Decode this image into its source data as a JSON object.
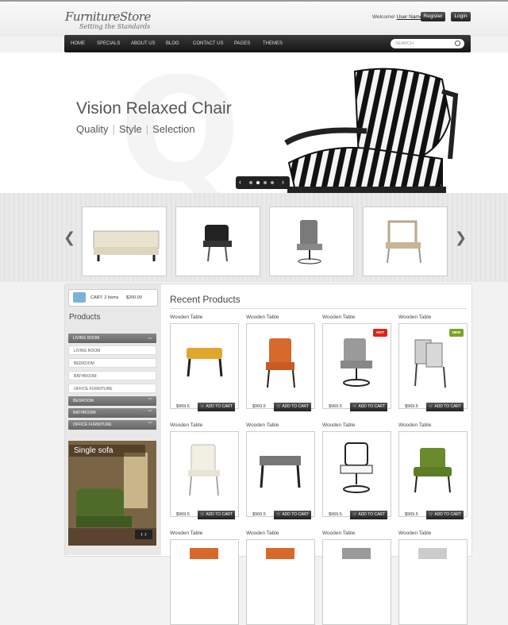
{
  "header": {
    "logo_brand": "FurnitureStore",
    "logo_tagline": "Setting the Standards",
    "welcome_text": "Welcome!",
    "user_name": "User Name",
    "register_label": "Register",
    "login_label": "Login"
  },
  "nav": {
    "items": [
      "HOME",
      "SPECIALS",
      "ABOUT US",
      "BLOG",
      "CONTACT US",
      "PAGES",
      "THEMES"
    ],
    "search_placeholder": "SEARCH"
  },
  "hero": {
    "title": "Vision Relaxed Chair",
    "sub": [
      "Quality",
      "Style",
      "Selection"
    ]
  },
  "sidebar": {
    "cart_text": "CART: 2 Items",
    "cart_total": "$200.00",
    "products_heading": "Products",
    "categories": [
      {
        "label": "LIVING ROOM",
        "style": "dark",
        "chev": "up"
      },
      {
        "label": "LIVING ROOM",
        "style": "light"
      },
      {
        "label": "BEDROOM",
        "style": "light"
      },
      {
        "label": "BATHROOM",
        "style": "light"
      },
      {
        "label": "OFFICE FURNITURE",
        "style": "light"
      },
      {
        "label": "BEDROOM",
        "style": "dark",
        "chev": "down"
      },
      {
        "label": "BATHROOM",
        "style": "dark",
        "chev": "down"
      },
      {
        "label": "OFFICE FURNITURE",
        "style": "dark",
        "chev": "down"
      }
    ],
    "feature_label": "Single sofa"
  },
  "recent": {
    "heading": "Recent Products",
    "products": [
      {
        "name": "Wooden Table",
        "price": "$969.5",
        "button": "ADD TO CART",
        "badge": ""
      },
      {
        "name": "Wooden Table",
        "price": "$969.5",
        "button": "ADD TO CART",
        "badge": ""
      },
      {
        "name": "Wooden Table",
        "price": "$969.5",
        "button": "ADD TO CART",
        "badge": "HOT"
      },
      {
        "name": "Wooden Table",
        "price": "$969.5",
        "button": "ADD TO CART",
        "badge": "NEW"
      },
      {
        "name": "Wooden Table",
        "price": "$969.5",
        "button": "ADD TO CART",
        "badge": ""
      },
      {
        "name": "Wooden Table",
        "price": "$969.5",
        "button": "ADD TO CART",
        "badge": ""
      },
      {
        "name": "Wooden Table",
        "price": "$969.5",
        "button": "ADD TO CART",
        "badge": ""
      },
      {
        "name": "Wooden Table",
        "price": "$969.5",
        "button": "ADD TO CART",
        "badge": ""
      },
      {
        "name": "Wooden Table",
        "price": "",
        "button": "",
        "badge": ""
      },
      {
        "name": "Wooden Table",
        "price": "",
        "button": "",
        "badge": ""
      },
      {
        "name": "Wooden Table",
        "price": "",
        "button": "",
        "badge": ""
      },
      {
        "name": "Wooden Table",
        "price": "",
        "button": "",
        "badge": ""
      }
    ]
  },
  "colors": {
    "hot_badge": "#d9261c",
    "new_badge": "#7aa32b",
    "nav_bg": "#1c1c1c"
  }
}
